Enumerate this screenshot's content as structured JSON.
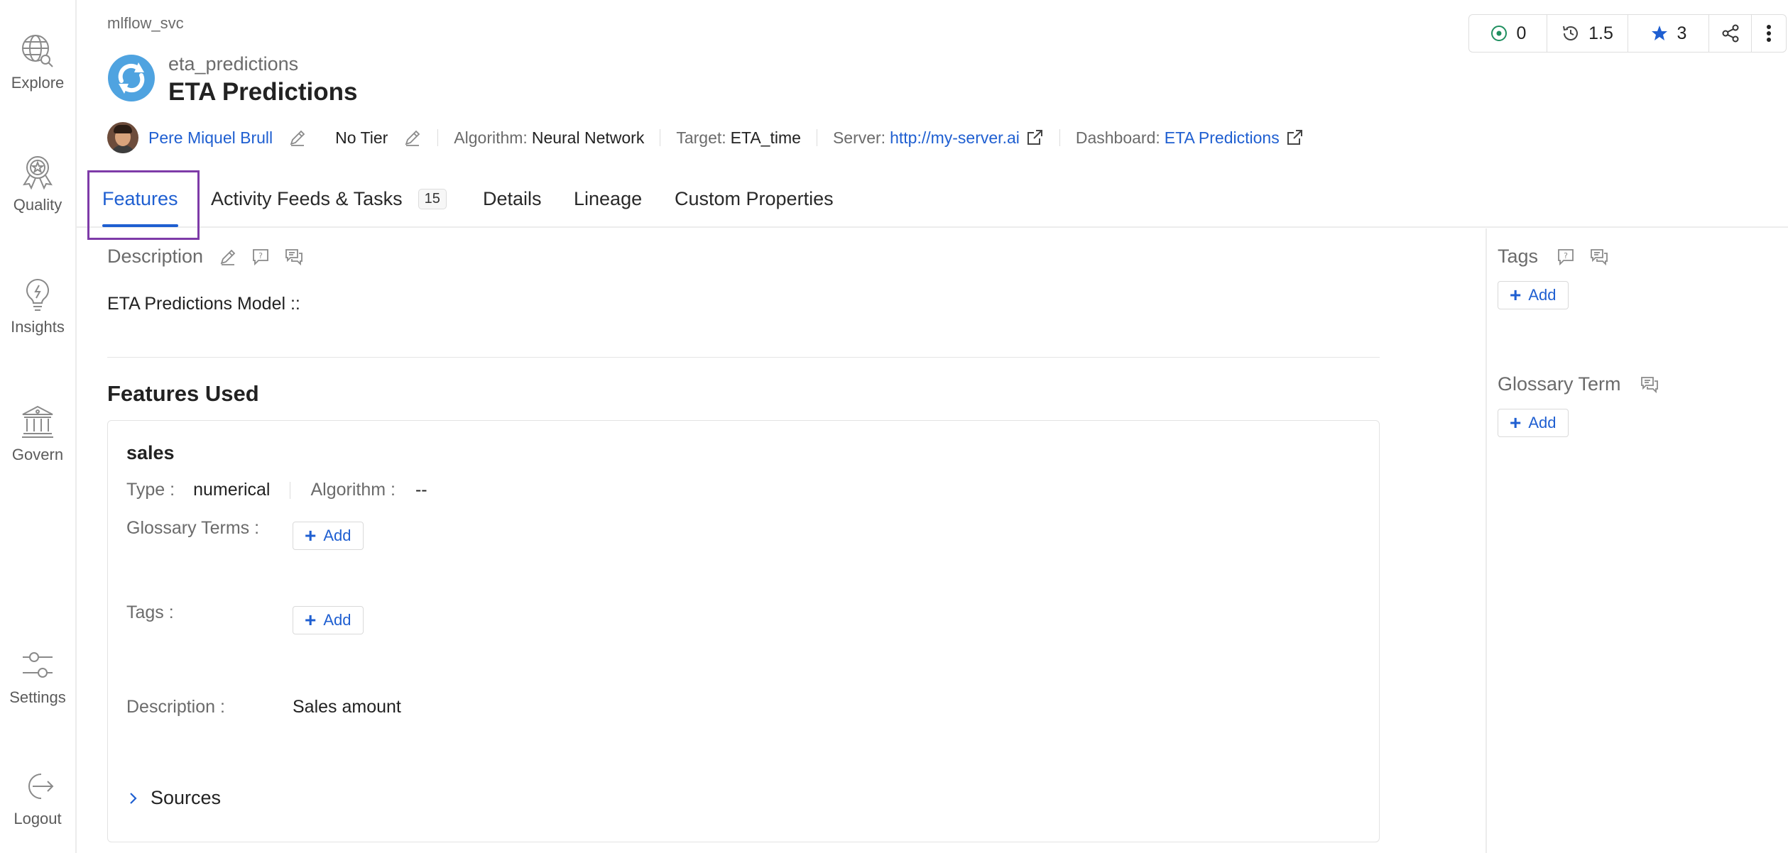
{
  "nav": {
    "items": [
      {
        "label": "Explore",
        "icon": "globe-search-icon"
      },
      {
        "label": "Quality",
        "icon": "badge-star-icon"
      },
      {
        "label": "Insights",
        "icon": "lightbulb-icon"
      },
      {
        "label": "Govern",
        "icon": "bank-icon"
      },
      {
        "label": "Settings",
        "icon": "sliders-icon"
      },
      {
        "label": "Logout",
        "icon": "logout-icon"
      }
    ]
  },
  "breadcrumb": "mlflow_svc",
  "entity": {
    "name": "eta_predictions",
    "display_name": "ETA Predictions"
  },
  "meta": {
    "owner": "Pere Miquel Brull",
    "tier": "No Tier",
    "algorithm_label": "Algorithm:",
    "algorithm_value": "Neural Network",
    "target_label": "Target:",
    "target_value": "ETA_time",
    "server_label": "Server:",
    "server_value": "http://my-server.ai",
    "dashboard_label": "Dashboard:",
    "dashboard_value": "ETA Predictions"
  },
  "actions": {
    "followers": "0",
    "version": "1.5",
    "stars": "3"
  },
  "tabs": [
    {
      "label": "Features",
      "active": true
    },
    {
      "label": "Activity Feeds & Tasks",
      "count": "15"
    },
    {
      "label": "Details"
    },
    {
      "label": "Lineage"
    },
    {
      "label": "Custom Properties"
    }
  ],
  "description": {
    "title": "Description",
    "text": "ETA Predictions Model ::"
  },
  "features": {
    "title": "Features Used",
    "items": [
      {
        "name": "sales",
        "type_label": "Type :",
        "type_value": "numerical",
        "algorithm_label": "Algorithm :",
        "algorithm_value": "--",
        "glossary_label": "Glossary Terms :",
        "tags_label": "Tags :",
        "description_label": "Description :",
        "description_value": "Sales amount",
        "sources_label": "Sources"
      }
    ]
  },
  "add_label": "Add",
  "right_panel": {
    "tags_title": "Tags",
    "glossary_title": "Glossary Term"
  },
  "colors": {
    "accent": "#1f5fd1",
    "focus": "#7e3ba8",
    "follow": "#1f8f5f"
  }
}
